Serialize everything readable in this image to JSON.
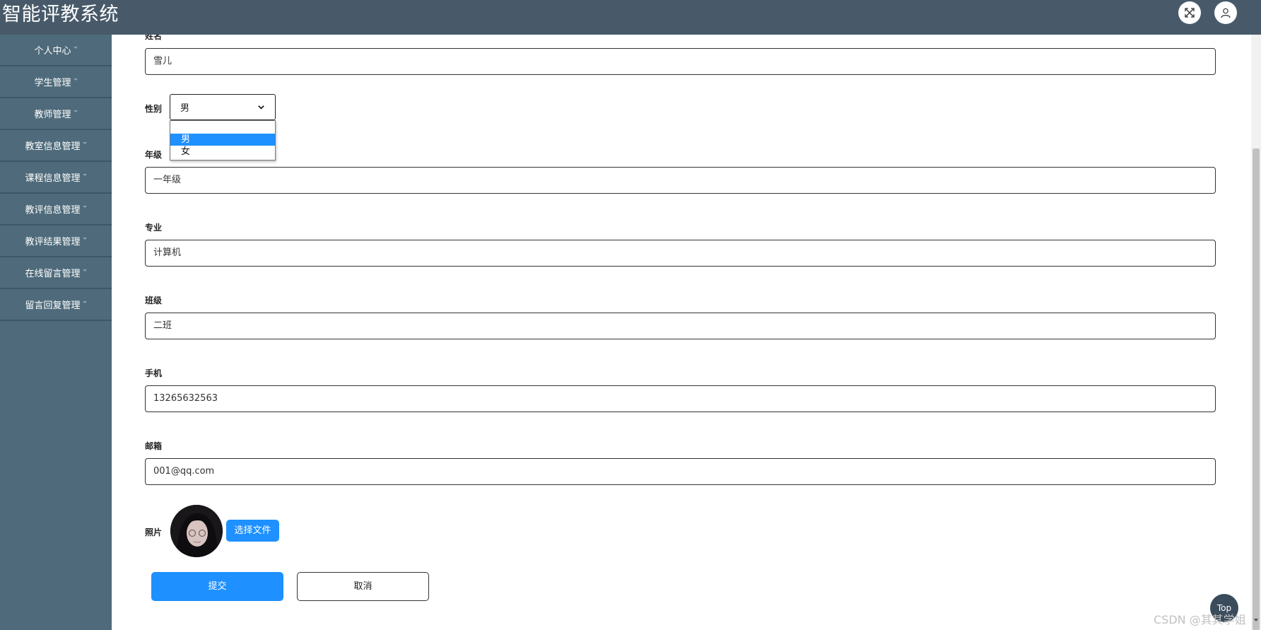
{
  "header": {
    "title": "智能评教系统",
    "fullscreen_icon": "expand-icon",
    "user_icon": "user-icon"
  },
  "sidebar": {
    "items": [
      {
        "label": "个人中心"
      },
      {
        "label": "学生管理"
      },
      {
        "label": "教师管理"
      },
      {
        "label": "教室信息管理"
      },
      {
        "label": "课程信息管理"
      },
      {
        "label": "教评信息管理"
      },
      {
        "label": "教评结果管理"
      },
      {
        "label": "在线留言管理"
      },
      {
        "label": "留言回复管理"
      }
    ]
  },
  "form": {
    "name": {
      "label": "姓名",
      "value": "雪儿"
    },
    "gender": {
      "label": "性别",
      "value": "男",
      "options": [
        "",
        "男",
        "女"
      ]
    },
    "grade": {
      "label": "年级",
      "value": "一年级"
    },
    "major": {
      "label": "专业",
      "value": "计算机"
    },
    "class": {
      "label": "班级",
      "value": "二班"
    },
    "phone": {
      "label": "手机",
      "value": "13265632563"
    },
    "email": {
      "label": "邮箱",
      "value": "001@qq.com"
    },
    "photo": {
      "label": "照片",
      "choose_label": "选择文件"
    },
    "submit_label": "提交",
    "cancel_label": "取消"
  },
  "top_button_label": "Top",
  "watermark": "CSDN @其其学姐",
  "colors": {
    "header_bg": "#485a6a",
    "sidebar_bg": "#4f6b7b",
    "accent": "#1e90ff"
  }
}
